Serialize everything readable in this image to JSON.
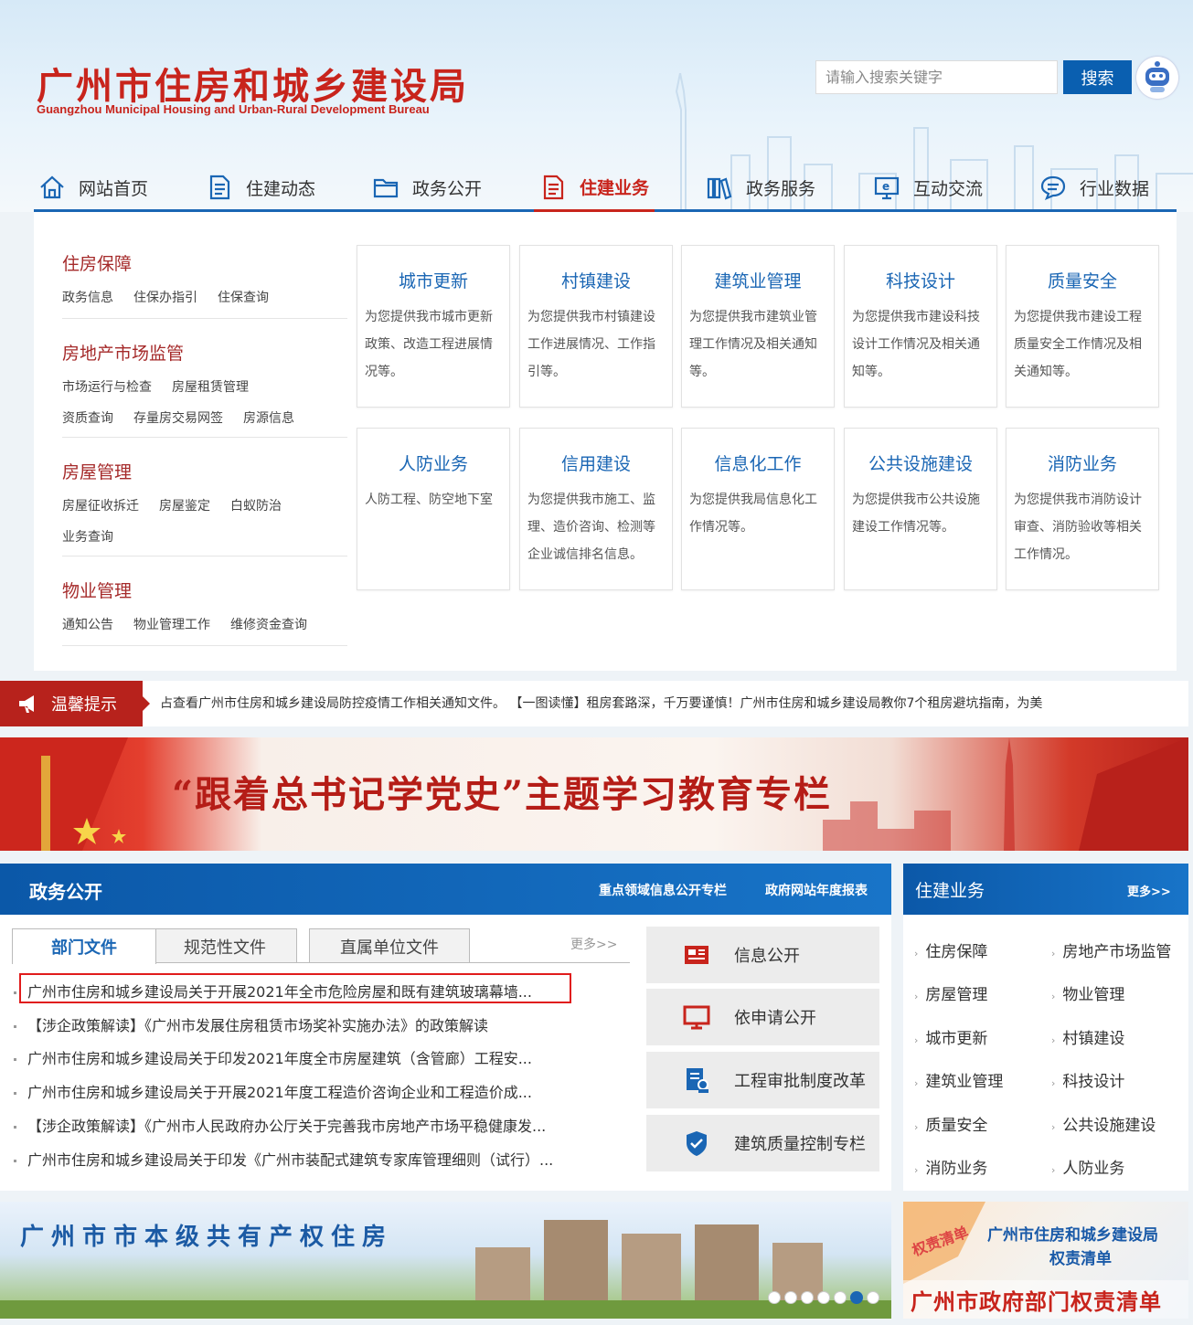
{
  "header": {
    "logo_cn": "广州市住房和城乡建设局",
    "logo_en": "Guangzhou Municipal Housing and Urban-Rural Development Bureau",
    "search_placeholder": "请输入搜索关键字",
    "search_button": "搜索"
  },
  "nav": [
    {
      "label": "网站首页",
      "icon": "home-icon"
    },
    {
      "label": "住建动态",
      "icon": "document-icon"
    },
    {
      "label": "政务公开",
      "icon": "folder-icon"
    },
    {
      "label": "住建业务",
      "icon": "document-icon",
      "active": true
    },
    {
      "label": "政务服务",
      "icon": "books-icon"
    },
    {
      "label": "互动交流",
      "icon": "monitor-icon"
    },
    {
      "label": "行业数据",
      "icon": "chat-icon"
    }
  ],
  "categories": [
    {
      "title": "住房保障",
      "links": [
        "政务信息",
        "住保办指引",
        "住保查询"
      ]
    },
    {
      "title": "房地产市场监管",
      "links": [
        "市场运行与检查",
        "房屋租赁管理",
        "资质查询",
        "存量房交易网签",
        "房源信息"
      ]
    },
    {
      "title": "房屋管理",
      "links": [
        "房屋征收拆迁",
        "房屋鉴定",
        "白蚁防治",
        "业务查询"
      ]
    },
    {
      "title": "物业管理",
      "links": [
        "通知公告",
        "物业管理工作",
        "维修资金查询"
      ]
    }
  ],
  "cards": [
    {
      "title": "城市更新",
      "desc": "为您提供我市城市更新政策、改造工程进展情况等。"
    },
    {
      "title": "村镇建设",
      "desc": "为您提供我市村镇建设工作进展情况、工作指引等。"
    },
    {
      "title": "建筑业管理",
      "desc": "为您提供我市建筑业管理工作情况及相关通知等。"
    },
    {
      "title": "科技设计",
      "desc": "为您提供我市建设科技设计工作情况及相关通知等。"
    },
    {
      "title": "质量安全",
      "desc": "为您提供我市建设工程质量安全工作情况及相关通知等。"
    },
    {
      "title": "人防业务",
      "desc": "人防工程、防空地下室"
    },
    {
      "title": "信用建设",
      "desc": "为您提供我市施工、监理、造价咨询、检测等企业诚信排名信息。"
    },
    {
      "title": "信息化工作",
      "desc": "为您提供我局信息化工作情况等。"
    },
    {
      "title": "公共设施建设",
      "desc": "为您提供我市公共设施建设工作情况等。"
    },
    {
      "title": "消防业务",
      "desc": "为您提供我市消防设计审查、消防验收等相关工作情况。"
    }
  ],
  "tip": {
    "label": "温馨提示",
    "text": "占查看广州市住房和城乡建设局防控疫情工作相关通知文件。     【一图读懂】租房套路深，千万要谨慎！广州市住房和城乡建设局教你7个租房避坑指南，为美"
  },
  "banner": {
    "text": "“跟着总书记学党史”主题学习教育专栏"
  },
  "zwgk": {
    "title": "政务公开",
    "link1": "重点领域信息公开专栏",
    "link2": "政府网站年度报表",
    "tabs": [
      "部门文件",
      "规范性文件",
      "直属单位文件"
    ],
    "more": "更多>>",
    "news": [
      "广州市住房和城乡建设局关于开展2021年全市危险房屋和既有建筑玻璃幕墙...",
      "【涉企政策解读】《广州市发展住房租赁市场奖补实施办法》的政策解读",
      "广州市住房和城乡建设局关于印发2021年度全市房屋建筑（含管廊）工程安...",
      "广州市住房和城乡建设局关于开展2021年度工程造价咨询企业和工程造价成...",
      "【涉企政策解读】《广州市人民政府办公厅关于完善我市房地产市场平稳健康发...",
      "广州市住房和城乡建设局关于印发《广州市装配式建筑专家库管理细则（试行）..."
    ],
    "quick": [
      {
        "label": "信息公开",
        "icon": "news-icon"
      },
      {
        "label": "依申请公开",
        "icon": "monitor-icon"
      },
      {
        "label": "工程审批制度改革",
        "icon": "approval-icon"
      },
      {
        "label": "建筑质量控制专栏",
        "icon": "shield-check-icon"
      }
    ]
  },
  "zjyw": {
    "title": "住建业务",
    "more": "更多>>",
    "items": [
      "住房保障",
      "房地产市场监管",
      "房屋管理",
      "物业管理",
      "城市更新",
      "村镇建设",
      "建筑业管理",
      "科技设计",
      "质量安全",
      "公共设施建设",
      "消防业务",
      "人防业务"
    ]
  },
  "bottom": {
    "banner1": "广州市市本级共有产权住房",
    "b2_line1": "广州市住房和城乡建设局",
    "b2_line2": "权责清单",
    "b2_line3": "广州市政府部门权责清单",
    "b2_tag": "权责清单"
  },
  "colors": {
    "brand_red": "#c8241c",
    "brand_blue": "#1a66b4"
  }
}
